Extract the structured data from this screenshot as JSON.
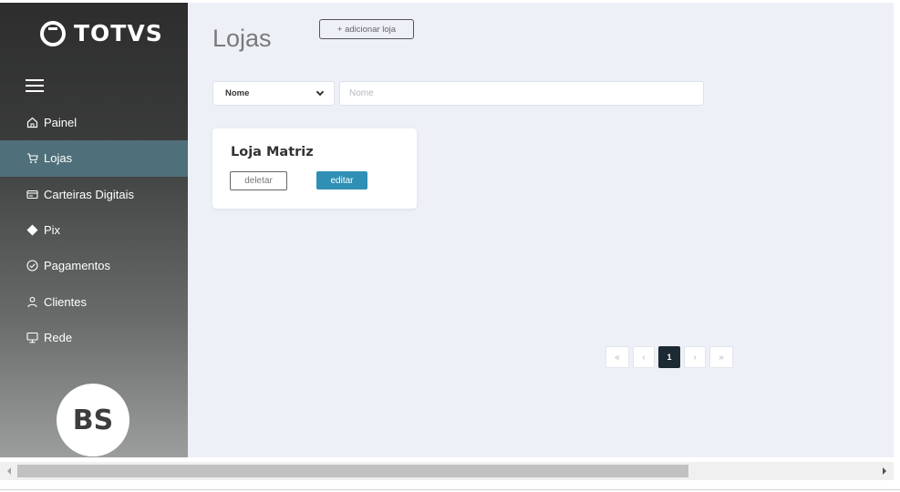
{
  "brand": {
    "name": "TOTVS"
  },
  "sidebar": {
    "items": [
      {
        "label": "Painel",
        "icon": "home-icon",
        "active": false
      },
      {
        "label": "Lojas",
        "icon": "cart-icon",
        "active": true
      },
      {
        "label": "Carteiras Digitais",
        "icon": "wallet-icon",
        "active": false
      },
      {
        "label": "Pix",
        "icon": "pix-icon",
        "active": false
      },
      {
        "label": "Pagamentos",
        "icon": "check-circle-icon",
        "active": false
      },
      {
        "label": "Clientes",
        "icon": "user-icon",
        "active": false
      },
      {
        "label": "Rede",
        "icon": "monitor-icon",
        "active": false
      }
    ],
    "avatar_initials": "BS"
  },
  "main": {
    "title": "Lojas",
    "add_button_label": "+ adicionar loja",
    "filter": {
      "select_value": "Nome",
      "input_placeholder": "Nome",
      "input_value": ""
    },
    "stores": [
      {
        "name": "Loja Matriz",
        "delete_label": "deletar",
        "edit_label": "editar"
      }
    ],
    "pagination": {
      "first": "«",
      "prev": "‹",
      "current": "1",
      "next": "›",
      "last": "»"
    }
  },
  "colors": {
    "accent": "#2f8fb4",
    "active_nav": "#4f6f7a",
    "page_bg": "#edf0f7",
    "pager_current": "#1d2a33"
  }
}
